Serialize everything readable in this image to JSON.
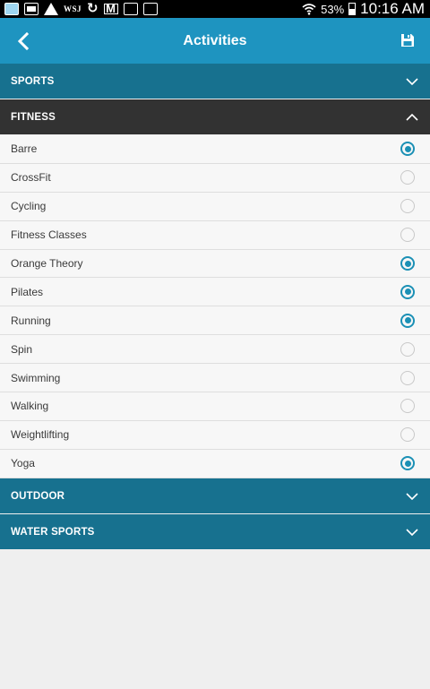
{
  "status_bar": {
    "carrier_text": "WSJ",
    "battery_percent": "53%",
    "battery_level": 0.53,
    "time": "10:16 AM"
  },
  "header": {
    "title": "Activities",
    "back_icon": "chevron-left-icon",
    "save_icon": "floppy-disk-icon"
  },
  "sections": {
    "sports": {
      "label": "SPORTS",
      "expanded": false
    },
    "fitness": {
      "label": "FITNESS",
      "expanded": true
    },
    "outdoor": {
      "label": "OUTDOOR",
      "expanded": false
    },
    "water_sports": {
      "label": "WATER SPORTS",
      "expanded": false
    }
  },
  "fitness_items": [
    {
      "label": "Barre",
      "selected": true
    },
    {
      "label": "CrossFit",
      "selected": false
    },
    {
      "label": "Cycling",
      "selected": false
    },
    {
      "label": "Fitness Classes",
      "selected": false
    },
    {
      "label": "Orange Theory",
      "selected": true
    },
    {
      "label": "Pilates",
      "selected": true
    },
    {
      "label": "Running",
      "selected": true
    },
    {
      "label": "Spin",
      "selected": false
    },
    {
      "label": "Swimming",
      "selected": false
    },
    {
      "label": "Walking",
      "selected": false
    },
    {
      "label": "Weightlifting",
      "selected": false
    },
    {
      "label": "Yoga",
      "selected": true
    }
  ],
  "colors": {
    "appbar": "#1e94c0",
    "section_collapsed": "#17718f",
    "section_expanded": "#323232",
    "radio_selected": "#1b90b5"
  }
}
